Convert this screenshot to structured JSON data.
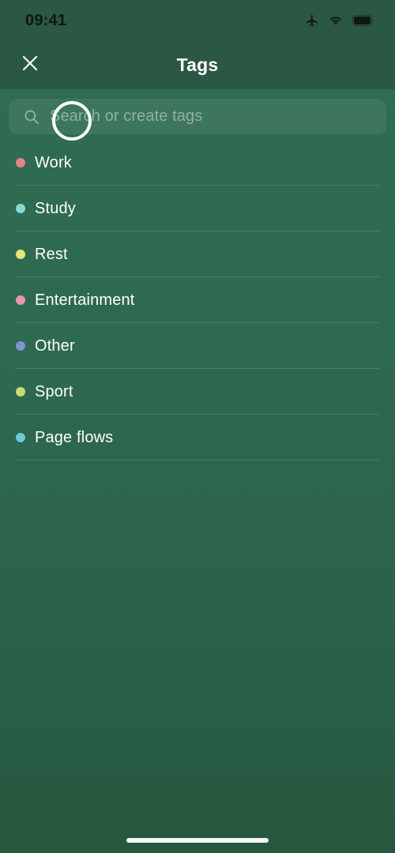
{
  "status_bar": {
    "time": "09:41",
    "icons": [
      {
        "name": "airplane-mode-icon"
      },
      {
        "name": "wifi-icon"
      },
      {
        "name": "battery-icon"
      }
    ]
  },
  "nav_bar": {
    "title": "Tags",
    "close_icon": "close-icon"
  },
  "search": {
    "icon": "search-icon",
    "placeholder": "Search or create tags",
    "value": ""
  },
  "tags": [
    {
      "label": "Work",
      "color": "#ed8080"
    },
    {
      "label": "Study",
      "color": "#8ad9d1"
    },
    {
      "label": "Rest",
      "color": "#e5e773"
    },
    {
      "label": "Entertainment",
      "color": "#e897b4"
    },
    {
      "label": "Other",
      "color": "#8293ce"
    },
    {
      "label": "Sport",
      "color": "#cbdb6f"
    },
    {
      "label": "Page flows",
      "color": "#6fc8d6"
    }
  ],
  "overlay": {
    "tap_indicator": "tap-indicator-ring"
  },
  "home_indicator": "home-indicator",
  "theme": {
    "background_top": "#2f6c51",
    "background_bottom": "#27573f",
    "header_background": "#2b5745",
    "text_primary": "#ffffff",
    "placeholder_color": "#8fb8a5"
  }
}
